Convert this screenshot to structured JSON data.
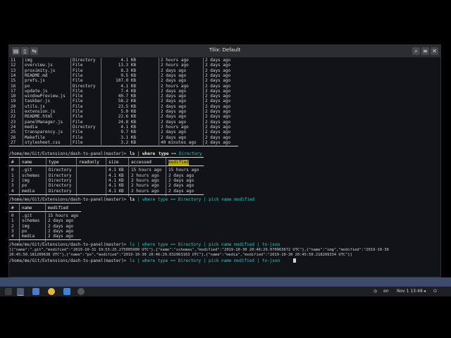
{
  "window": {
    "title": "Tilix: Default"
  },
  "top_listing": {
    "rows": [
      [
        "11",
        "img",
        "Directory",
        "4.1 KB",
        "2 hours ago",
        "2 days ago"
      ],
      [
        "12",
        "overview.js",
        "File",
        "13.3 KB",
        "2 hours ago",
        "2 days ago"
      ],
      [
        "13",
        "proximity.js",
        "File",
        "8.3 KB",
        "2 days ago",
        "2 days ago"
      ],
      [
        "14",
        "README.md",
        "File",
        "9.5 KB",
        "2 days ago",
        "2 days ago"
      ],
      [
        "15",
        "prefs.js",
        "File",
        "107.0 KB",
        "2 days ago",
        "2 days ago"
      ],
      [
        "16",
        "po",
        "Directory",
        "4.1 KB",
        "2 hours ago",
        "2 days ago"
      ],
      [
        "17",
        "update.js",
        "File",
        "7.4 KB",
        "2 days ago",
        "2 days ago"
      ],
      [
        "18",
        "windowPreview.js",
        "File",
        "40.7 KB",
        "2 days ago",
        "2 days ago"
      ],
      [
        "19",
        "taskbar.js",
        "File",
        "58.2 KB",
        "2 days ago",
        "2 days ago"
      ],
      [
        "20",
        "utils.js",
        "File",
        "23.5 KB",
        "2 days ago",
        "2 days ago"
      ],
      [
        "21",
        "extension.js",
        "File",
        "5.0 KB",
        "2 days ago",
        "2 days ago"
      ],
      [
        "22",
        "README.html",
        "File",
        "22.6 KB",
        "2 days ago",
        "2 days ago"
      ],
      [
        "23",
        "panelManager.js",
        "File",
        "24.8 KB",
        "2 days ago",
        "2 days ago"
      ],
      [
        "24",
        "media",
        "Directory",
        "4.1 KB",
        "2 hours ago",
        "2 days ago"
      ],
      [
        "25",
        "transparency.js",
        "File",
        "9.7 KB",
        "2 days ago",
        "2 days ago"
      ],
      [
        "26",
        "Makefile",
        "File",
        "3.1 KB",
        "2 days ago",
        "2 days ago"
      ],
      [
        "27",
        "stylesheet.css",
        "File",
        "3.2 KB",
        "40 minutes ago",
        "2 days ago"
      ]
    ]
  },
  "prompt1": {
    "path": "/home/me/Git/Extensions/dash-to-panel(master)>",
    "cmd": "ls",
    "sep": "|",
    "where": "where",
    "field": "type",
    "eq": "==",
    "value": "Directory"
  },
  "table1": {
    "headers": [
      "#",
      "name",
      "type",
      "readonly",
      "size",
      "accessed",
      "modified"
    ],
    "rows": [
      [
        "0",
        ".git",
        "Directory",
        "",
        "4.1 KB",
        "15 hours ago",
        "15 hours ago"
      ],
      [
        "1",
        "schemas",
        "Directory",
        "",
        "4.1 KB",
        "2 hours ago",
        "2 days ago"
      ],
      [
        "2",
        "img",
        "Directory",
        "",
        "4.1 KB",
        "2 hours ago",
        "2 days ago"
      ],
      [
        "3",
        "po",
        "Directory",
        "",
        "4.1 KB",
        "2 hours ago",
        "2 days ago"
      ],
      [
        "4",
        "media",
        "Directory",
        "",
        "4.1 KB",
        "2 hours ago",
        "2 days ago"
      ]
    ]
  },
  "prompt2": {
    "path": "/home/me/Git/Extensions/dash-to-panel(master)>",
    "text_a": "ls",
    "text_b": "| where type == Directory | pick name modified"
  },
  "table2": {
    "headers": [
      "#",
      "name",
      "modified"
    ],
    "rows": [
      [
        "0",
        ".git",
        "15 hours ago"
      ],
      [
        "1",
        "schemas",
        "2 days ago"
      ],
      [
        "2",
        "img",
        "2 days ago"
      ],
      [
        "3",
        "po",
        "2 days ago"
      ],
      [
        "4",
        "media",
        "2 days ago"
      ]
    ]
  },
  "prompt3": {
    "path": "/home/me/Git/Extensions/dash-to-panel(master)>",
    "text": "ls | where type == Directory | pick name modified | to-json"
  },
  "json_output": {
    "line1": "[{\"name\":\".git\",\"modified\":\"2019-10-31 19:53:25.275005900 UTC\"},{\"name\":\"schemas\",\"modified\":\"2019-10-30 20:46:29.070963672 UTC\"},{\"name\":\"img\",\"modified\":\"2019-10-30",
    "line2": "20:45:50.181209638 UTC\"},{\"name\":\"po\",\"modified\":\"2019-10-30 20:46:29.032963163 UTC\"},{\"name\":\"media\",\"modified\":\"2019-10-30 20:45:50.218209334 UTC\"}]"
  },
  "prompt4": {
    "path": "/home/me/Git/Extensions/dash-to-panel(master)>",
    "text": "ls | where type == Directory | pick name modified | to-json"
  },
  "tray": {
    "lang": "en",
    "clock": "Nov 1 13:48"
  },
  "colors": {
    "terminal_bg": "#111316",
    "highlight": "#b7a900",
    "string": "#33c2c2"
  }
}
